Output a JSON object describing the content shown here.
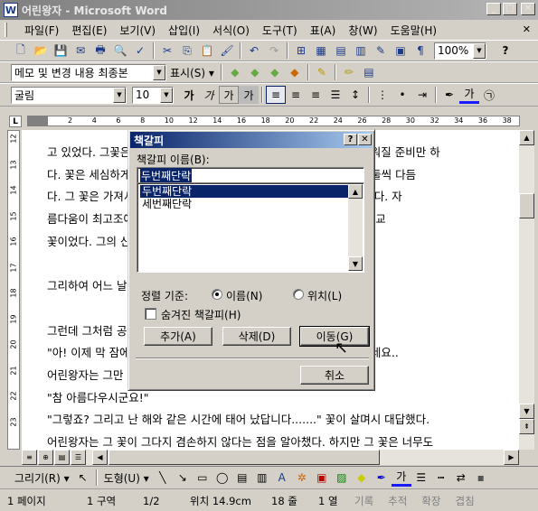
{
  "window": {
    "title": "어린왕자 - Microsoft Word",
    "app_icon": "W",
    "min": "_",
    "max": "□",
    "close": "✕"
  },
  "menu": {
    "items": [
      "파일(F)",
      "편집(E)",
      "보기(V)",
      "삽입(I)",
      "서식(O)",
      "도구(T)",
      "표(A)",
      "창(W)",
      "도움말(H)"
    ],
    "help_button": "✕"
  },
  "standard_toolbar": {
    "zoom": "100%",
    "help": "?"
  },
  "review_toolbar": {
    "view_select": "메모 및 변경 내용 최종본",
    "show_label": "표시(S) ▾"
  },
  "format_toolbar": {
    "font": "굴림",
    "size": "10",
    "bold": "가",
    "italic": "가",
    "underline_a": "가",
    "underline_b": "가",
    "font_color": "가"
  },
  "ruler": {
    "tab_selector": "L",
    "numbers": [
      "2",
      "4",
      "6",
      "8",
      "10",
      "12",
      "14",
      "16",
      "18",
      "20",
      "22",
      "24",
      "26",
      "28",
      "30",
      "32",
      "34",
      "36",
      "38"
    ]
  },
  "vruler": {
    "numbers": [
      "12",
      "13",
      "14",
      "15",
      "16",
      "17",
      "18",
      "19",
      "20",
      "21",
      "22",
      "23"
    ]
  },
  "document": {
    "lines": [
      "고 있었다. 그꽃은 아무 아아이아이아나 아아이나가 가없이 고 아름다워질 준비만 하",
      "다. 꽃은 세심하게 자기 빛깔을 고르고 아아아 옷을 입고 꽃잎을 하나 둘씩 다듬",
      "다. 그 꽃은 가져서 아아아이 아아이아 모습을 드러내고 싶어하지 않았다. 자",
      "름다움이 최고조에 이르렀을 때 나타나고 싶어 했다. 아! 정말, 아주 애교",
      "꽃이었다. 그의 신비로운 단장은 며칠이고 계속되었다.",
      "",
      "그리하여 어느 날 아침, 해가 뜨는 시간에 정확히 그 모습을 드러냈다.",
      "",
      "그런데 그처럼 공들여 준비한 꽃은 하품을 하며 말하는 것이었다.",
      "\"아! 이제 막 잠에서 깨어났어요... 미안해요... 아직 온통 헝클어져 있네요..",
      "어린왕자는 그만 감탄을 감출 수가 없었다.",
      "\"참 아름다우시군요!\"",
      "\"그렇죠? 그리고 난 해와 같은 시간에 태어 났답니다.......\" 꽃이 살며시 대답했다.",
      "어린왕자는 그 꽃이 그다지 겸손하지 않다는 점을 알아챘다. 하지만 그 꽃은 너무도"
    ]
  },
  "dialog": {
    "title": "책갈피",
    "help": "?",
    "close": "✕",
    "name_label": "책갈피 이름(B):",
    "name_value": "두번째단락",
    "list": [
      "두번째단락",
      "세번째단락"
    ],
    "sort_label": "정렬 기준:",
    "sort_by_name": "이름(N)",
    "sort_by_location": "위치(L)",
    "hidden_label": "숨겨진 책갈피(H)",
    "add_button": "추가(A)",
    "delete_button": "삭제(D)",
    "goto_button": "이동(G)",
    "cancel_button": "취소"
  },
  "drawing_toolbar": {
    "draw": "그리기(R) ▾",
    "autoshapes": "도형(U) ▾"
  },
  "status": {
    "page": "1 페이지",
    "section": "1 구역",
    "pages": "1/2",
    "position": "위치 14.9cm",
    "line": "18 줄",
    "column": "1 열",
    "rec": "기록",
    "trk": "추적",
    "ext": "확장",
    "ovr": "겹침"
  }
}
